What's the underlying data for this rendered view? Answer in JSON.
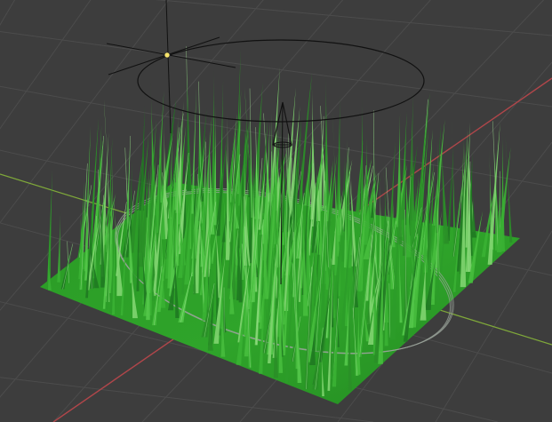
{
  "viewport": {
    "background_color": "#3d3d3d",
    "grid_color": "#4c4c4c",
    "x_axis_color": "#b0464a",
    "y_axis_color": "#7fa83a",
    "selection_outline_color": "#111111"
  },
  "objects": {
    "light": {
      "type": "point-light",
      "center_color": "#f6e36b"
    },
    "emitter": {
      "type": "circle-empty"
    },
    "camera_marker": {
      "type": "cone"
    },
    "grass": {
      "type": "particle-hair",
      "base_color": "#2fa42a",
      "blade_light_color": "#7fd46f",
      "blade_dark_color": "#1f7a22"
    },
    "ground_ring": {
      "type": "circle-outline",
      "color": "#9aa39a"
    }
  }
}
